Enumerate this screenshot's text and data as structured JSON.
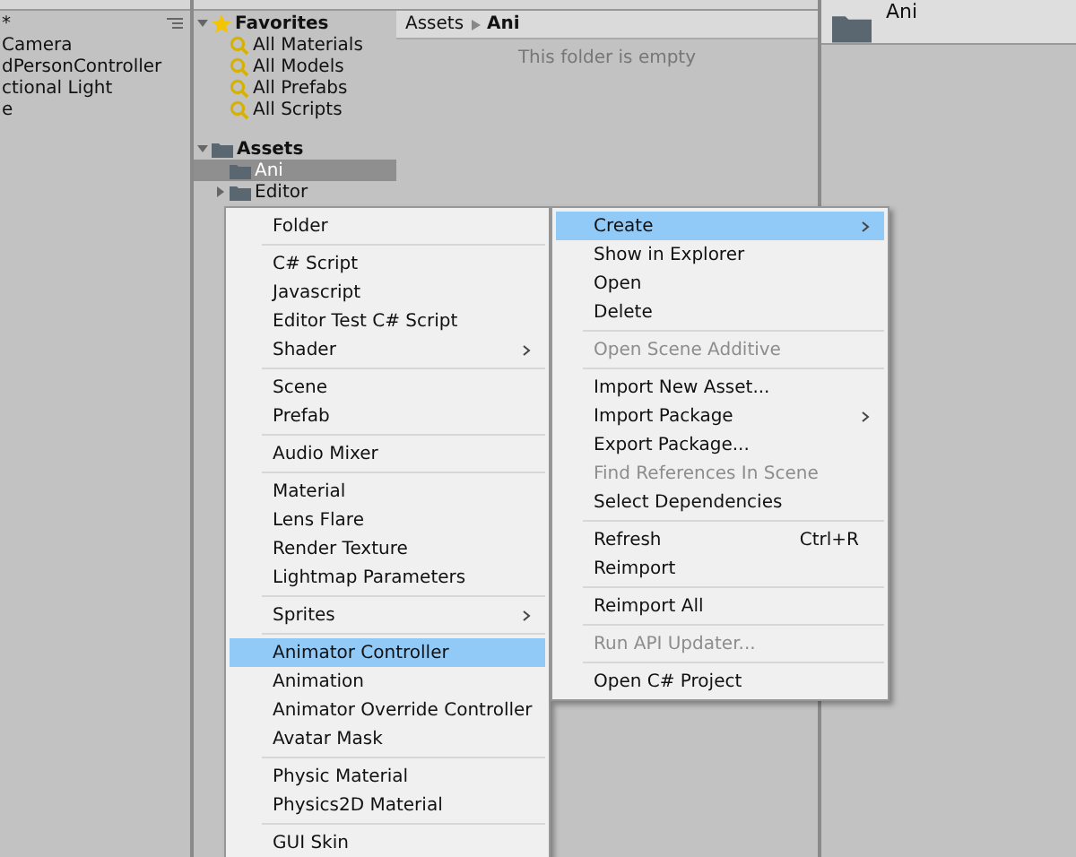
{
  "hierarchy": {
    "header": "*",
    "items": [
      "Camera",
      "dPersonController",
      "ctional Light",
      "e"
    ]
  },
  "project_tree": {
    "favorites": {
      "label": "Favorites",
      "expanded": true,
      "items": [
        "All Materials",
        "All Models",
        "All Prefabs",
        "All Scripts"
      ]
    },
    "assets": {
      "label": "Assets",
      "expanded": true,
      "children": [
        {
          "label": "Ani",
          "selected": true,
          "has_children": false
        },
        {
          "label": "Editor",
          "selected": false,
          "has_children": true
        }
      ]
    }
  },
  "content": {
    "breadcrumb": [
      "Assets",
      "Ani"
    ],
    "message": "This folder is empty"
  },
  "preview": {
    "label": "Ani"
  },
  "context_menu": [
    {
      "kind": "item",
      "label": "Create",
      "selected": true,
      "submenu": true,
      "disabled": false
    },
    {
      "kind": "item",
      "label": "Show in Explorer",
      "selected": false,
      "disabled": false
    },
    {
      "kind": "item",
      "label": "Open",
      "selected": false,
      "disabled": false
    },
    {
      "kind": "item",
      "label": "Delete",
      "selected": false,
      "disabled": false
    },
    {
      "kind": "separator"
    },
    {
      "kind": "item",
      "label": "Open Scene Additive",
      "selected": false,
      "disabled": true
    },
    {
      "kind": "separator"
    },
    {
      "kind": "item",
      "label": "Import New Asset...",
      "selected": false,
      "disabled": false
    },
    {
      "kind": "item",
      "label": "Import Package",
      "selected": false,
      "submenu": true,
      "disabled": false
    },
    {
      "kind": "item",
      "label": "Export Package...",
      "selected": false,
      "disabled": false
    },
    {
      "kind": "item",
      "label": "Find References In Scene",
      "selected": false,
      "disabled": true
    },
    {
      "kind": "item",
      "label": "Select Dependencies",
      "selected": false,
      "disabled": false
    },
    {
      "kind": "separator"
    },
    {
      "kind": "item",
      "label": "Refresh",
      "shortcut": "Ctrl+R",
      "selected": false,
      "disabled": false
    },
    {
      "kind": "item",
      "label": "Reimport",
      "selected": false,
      "disabled": false
    },
    {
      "kind": "separator"
    },
    {
      "kind": "item",
      "label": "Reimport All",
      "selected": false,
      "disabled": false
    },
    {
      "kind": "separator"
    },
    {
      "kind": "item",
      "label": "Run API Updater...",
      "selected": false,
      "disabled": true
    },
    {
      "kind": "separator"
    },
    {
      "kind": "item",
      "label": "Open C# Project",
      "selected": false,
      "disabled": false
    }
  ],
  "create_submenu": [
    {
      "kind": "item",
      "label": "Folder",
      "selected": false
    },
    {
      "kind": "separator"
    },
    {
      "kind": "item",
      "label": "C# Script",
      "selected": false
    },
    {
      "kind": "item",
      "label": "Javascript",
      "selected": false
    },
    {
      "kind": "item",
      "label": "Editor Test C# Script",
      "selected": false
    },
    {
      "kind": "item",
      "label": "Shader",
      "selected": false,
      "submenu": true
    },
    {
      "kind": "separator"
    },
    {
      "kind": "item",
      "label": "Scene",
      "selected": false
    },
    {
      "kind": "item",
      "label": "Prefab",
      "selected": false
    },
    {
      "kind": "separator"
    },
    {
      "kind": "item",
      "label": "Audio Mixer",
      "selected": false
    },
    {
      "kind": "separator"
    },
    {
      "kind": "item",
      "label": "Material",
      "selected": false
    },
    {
      "kind": "item",
      "label": "Lens Flare",
      "selected": false
    },
    {
      "kind": "item",
      "label": "Render Texture",
      "selected": false
    },
    {
      "kind": "item",
      "label": "Lightmap Parameters",
      "selected": false
    },
    {
      "kind": "separator"
    },
    {
      "kind": "item",
      "label": "Sprites",
      "selected": false,
      "submenu": true
    },
    {
      "kind": "separator"
    },
    {
      "kind": "item",
      "label": "Animator Controller",
      "selected": true
    },
    {
      "kind": "item",
      "label": "Animation",
      "selected": false
    },
    {
      "kind": "item",
      "label": "Animator Override Controller",
      "selected": false
    },
    {
      "kind": "item",
      "label": "Avatar Mask",
      "selected": false
    },
    {
      "kind": "separator"
    },
    {
      "kind": "item",
      "label": "Physic Material",
      "selected": false
    },
    {
      "kind": "item",
      "label": "Physics2D Material",
      "selected": false
    },
    {
      "kind": "separator"
    },
    {
      "kind": "item",
      "label": "GUI Skin",
      "selected": false
    }
  ]
}
